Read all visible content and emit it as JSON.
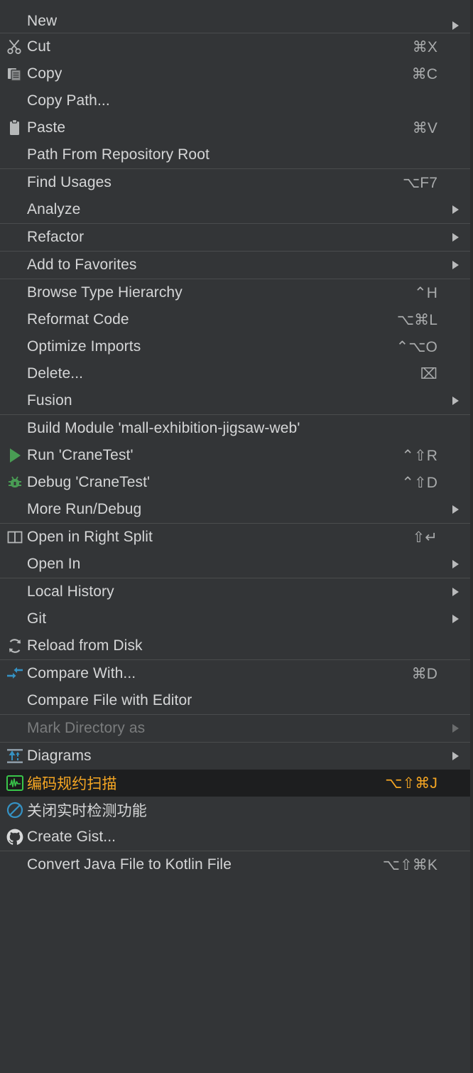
{
  "menu": {
    "name": "project-file-context-menu",
    "theme": {
      "background": "#333537",
      "text": "#d5d6d7",
      "disabled_text": "#7a7c7d",
      "separator": "#4a4c4d",
      "selected_background": "#1d1e1f",
      "selected_text": "#f5a623",
      "accent_green": "#499c54",
      "accent_blue": "#3592c4"
    },
    "groups": [
      {
        "id": "group-new",
        "items": [
          {
            "id": "new",
            "label": "New",
            "shortcut": "",
            "icon": "",
            "submenu": true,
            "disabled": false,
            "selected": false,
            "partial": true
          }
        ]
      },
      {
        "id": "group-clipboard",
        "items": [
          {
            "id": "cut",
            "label": "Cut",
            "shortcut": "⌘X",
            "icon": "scissors-icon",
            "submenu": false,
            "disabled": false,
            "selected": false
          },
          {
            "id": "copy",
            "label": "Copy",
            "shortcut": "⌘C",
            "icon": "copy-icon",
            "submenu": false,
            "disabled": false,
            "selected": false
          },
          {
            "id": "copy-path",
            "label": "Copy Path...",
            "shortcut": "",
            "icon": "",
            "submenu": false,
            "disabled": false,
            "selected": false
          },
          {
            "id": "paste",
            "label": "Paste",
            "shortcut": "⌘V",
            "icon": "clipboard-icon",
            "submenu": false,
            "disabled": false,
            "selected": false
          },
          {
            "id": "path-from-repository-root",
            "label": "Path From Repository Root",
            "shortcut": "",
            "icon": "",
            "submenu": false,
            "disabled": false,
            "selected": false
          }
        ]
      },
      {
        "id": "group-find",
        "items": [
          {
            "id": "find-usages",
            "label": "Find Usages",
            "shortcut": "⌥F7",
            "icon": "",
            "submenu": false,
            "disabled": false,
            "selected": false
          },
          {
            "id": "analyze",
            "label": "Analyze",
            "shortcut": "",
            "icon": "",
            "submenu": true,
            "disabled": false,
            "selected": false
          }
        ]
      },
      {
        "id": "group-refactor",
        "items": [
          {
            "id": "refactor",
            "label": "Refactor",
            "shortcut": "",
            "icon": "",
            "submenu": true,
            "disabled": false,
            "selected": false
          }
        ]
      },
      {
        "id": "group-favorites",
        "items": [
          {
            "id": "add-to-favorites",
            "label": "Add to Favorites",
            "shortcut": "",
            "icon": "",
            "submenu": true,
            "disabled": false,
            "selected": false
          }
        ]
      },
      {
        "id": "group-code",
        "items": [
          {
            "id": "browse-type-hierarchy",
            "label": "Browse Type Hierarchy",
            "shortcut": "⌃H",
            "icon": "",
            "submenu": false,
            "disabled": false,
            "selected": false
          },
          {
            "id": "reformat-code",
            "label": "Reformat Code",
            "shortcut": "⌥⌘L",
            "icon": "",
            "submenu": false,
            "disabled": false,
            "selected": false
          },
          {
            "id": "optimize-imports",
            "label": "Optimize Imports",
            "shortcut": "⌃⌥O",
            "icon": "",
            "submenu": false,
            "disabled": false,
            "selected": false
          },
          {
            "id": "delete",
            "label": "Delete...",
            "shortcut": "⌧",
            "icon": "",
            "submenu": false,
            "disabled": false,
            "selected": false
          },
          {
            "id": "fusion",
            "label": "Fusion",
            "shortcut": "",
            "icon": "",
            "submenu": true,
            "disabled": false,
            "selected": false
          }
        ]
      },
      {
        "id": "group-run",
        "items": [
          {
            "id": "build-module",
            "label": "Build Module 'mall-exhibition-jigsaw-web'",
            "shortcut": "",
            "icon": "",
            "submenu": false,
            "disabled": false,
            "selected": false
          },
          {
            "id": "run-cranetest",
            "label": "Run 'CraneTest'",
            "shortcut": "⌃⇧R",
            "icon": "run-icon",
            "submenu": false,
            "disabled": false,
            "selected": false
          },
          {
            "id": "debug-cranetest",
            "label": "Debug 'CraneTest'",
            "shortcut": "⌃⇧D",
            "icon": "debug-icon",
            "submenu": false,
            "disabled": false,
            "selected": false
          },
          {
            "id": "more-run-debug",
            "label": "More Run/Debug",
            "shortcut": "",
            "icon": "",
            "submenu": true,
            "disabled": false,
            "selected": false
          }
        ]
      },
      {
        "id": "group-open",
        "items": [
          {
            "id": "open-in-right-split",
            "label": "Open in Right Split",
            "shortcut": "⇧↵",
            "icon": "split-panes-icon",
            "submenu": false,
            "disabled": false,
            "selected": false
          },
          {
            "id": "open-in",
            "label": "Open In",
            "shortcut": "",
            "icon": "",
            "submenu": true,
            "disabled": false,
            "selected": false
          }
        ]
      },
      {
        "id": "group-vcs",
        "items": [
          {
            "id": "local-history",
            "label": "Local History",
            "shortcut": "",
            "icon": "",
            "submenu": true,
            "disabled": false,
            "selected": false
          },
          {
            "id": "git",
            "label": "Git",
            "shortcut": "",
            "icon": "",
            "submenu": true,
            "disabled": false,
            "selected": false
          },
          {
            "id": "reload-from-disk",
            "label": "Reload from Disk",
            "shortcut": "",
            "icon": "reload-icon",
            "submenu": false,
            "disabled": false,
            "selected": false
          }
        ]
      },
      {
        "id": "group-compare",
        "items": [
          {
            "id": "compare-with",
            "label": "Compare With...",
            "shortcut": "⌘D",
            "icon": "compare-icon",
            "submenu": false,
            "disabled": false,
            "selected": false
          },
          {
            "id": "compare-file-with-editor",
            "label": "Compare File with Editor",
            "shortcut": "",
            "icon": "",
            "submenu": false,
            "disabled": false,
            "selected": false
          }
        ]
      },
      {
        "id": "group-mark",
        "items": [
          {
            "id": "mark-directory-as",
            "label": "Mark Directory as",
            "shortcut": "",
            "icon": "",
            "submenu": true,
            "disabled": true,
            "selected": false
          }
        ]
      },
      {
        "id": "group-tools",
        "items": [
          {
            "id": "diagrams",
            "label": "Diagrams",
            "shortcut": "",
            "icon": "diagram-icon",
            "submenu": true,
            "disabled": false,
            "selected": false
          },
          {
            "id": "code-convention-scan",
            "label": "编码规约扫描",
            "shortcut": "⌥⇧⌘J",
            "icon": "waveform-icon",
            "submenu": false,
            "disabled": false,
            "selected": true
          },
          {
            "id": "disable-realtime-inspection",
            "label": "关闭实时检测功能",
            "shortcut": "",
            "icon": "block-icon",
            "submenu": false,
            "disabled": false,
            "selected": false
          },
          {
            "id": "create-gist",
            "label": "Create Gist...",
            "shortcut": "",
            "icon": "github-icon",
            "submenu": false,
            "disabled": false,
            "selected": false
          }
        ]
      },
      {
        "id": "group-kotlin",
        "items": [
          {
            "id": "convert-java-to-kotlin",
            "label": "Convert Java File to Kotlin File",
            "shortcut": "⌥⇧⌘K",
            "icon": "",
            "submenu": false,
            "disabled": false,
            "selected": false
          }
        ]
      }
    ]
  }
}
